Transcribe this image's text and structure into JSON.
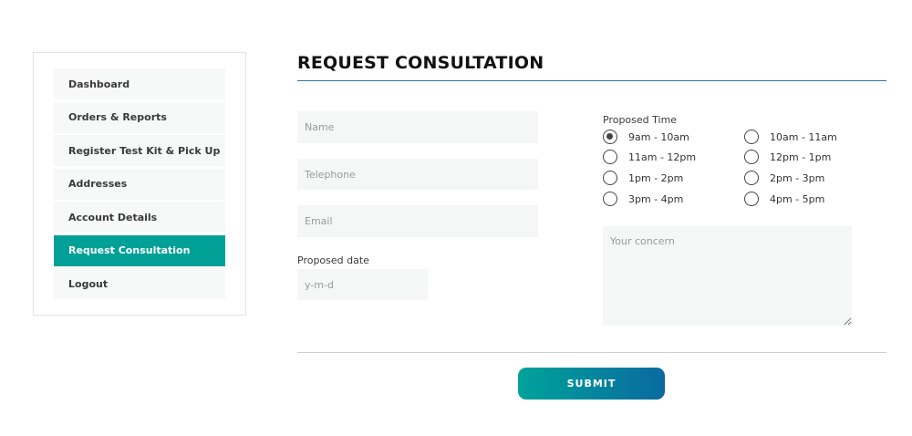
{
  "sidebar": {
    "items": [
      {
        "label": "Dashboard"
      },
      {
        "label": "Orders & Reports"
      },
      {
        "label": "Register Test Kit & Pick Up"
      },
      {
        "label": "Addresses"
      },
      {
        "label": "Account Details"
      },
      {
        "label": "Request Consultation"
      },
      {
        "label": "Logout"
      }
    ],
    "active_item": "Request Consultation",
    "active_color": "#00a096"
  },
  "page": {
    "title": "REQUEST CONSULTATION"
  },
  "form": {
    "name_placeholder": "Name",
    "telephone_placeholder": "Telephone",
    "email_placeholder": "Email",
    "proposed_date_label": "Proposed date",
    "proposed_date_placeholder": "y-m-d",
    "proposed_time_label": "Proposed Time",
    "time_options": [
      {
        "label": "9am - 10am",
        "checked": true
      },
      {
        "label": "10am - 11am",
        "checked": false
      },
      {
        "label": "11am - 12pm",
        "checked": false
      },
      {
        "label": "12pm - 1pm",
        "checked": false
      },
      {
        "label": "1pm - 2pm",
        "checked": false
      },
      {
        "label": "2pm - 3pm",
        "checked": false
      },
      {
        "label": "3pm - 4pm",
        "checked": false
      },
      {
        "label": "4pm - 5pm",
        "checked": false
      }
    ],
    "concern_placeholder": "Your concern",
    "submit_label": "SUBMIT"
  }
}
